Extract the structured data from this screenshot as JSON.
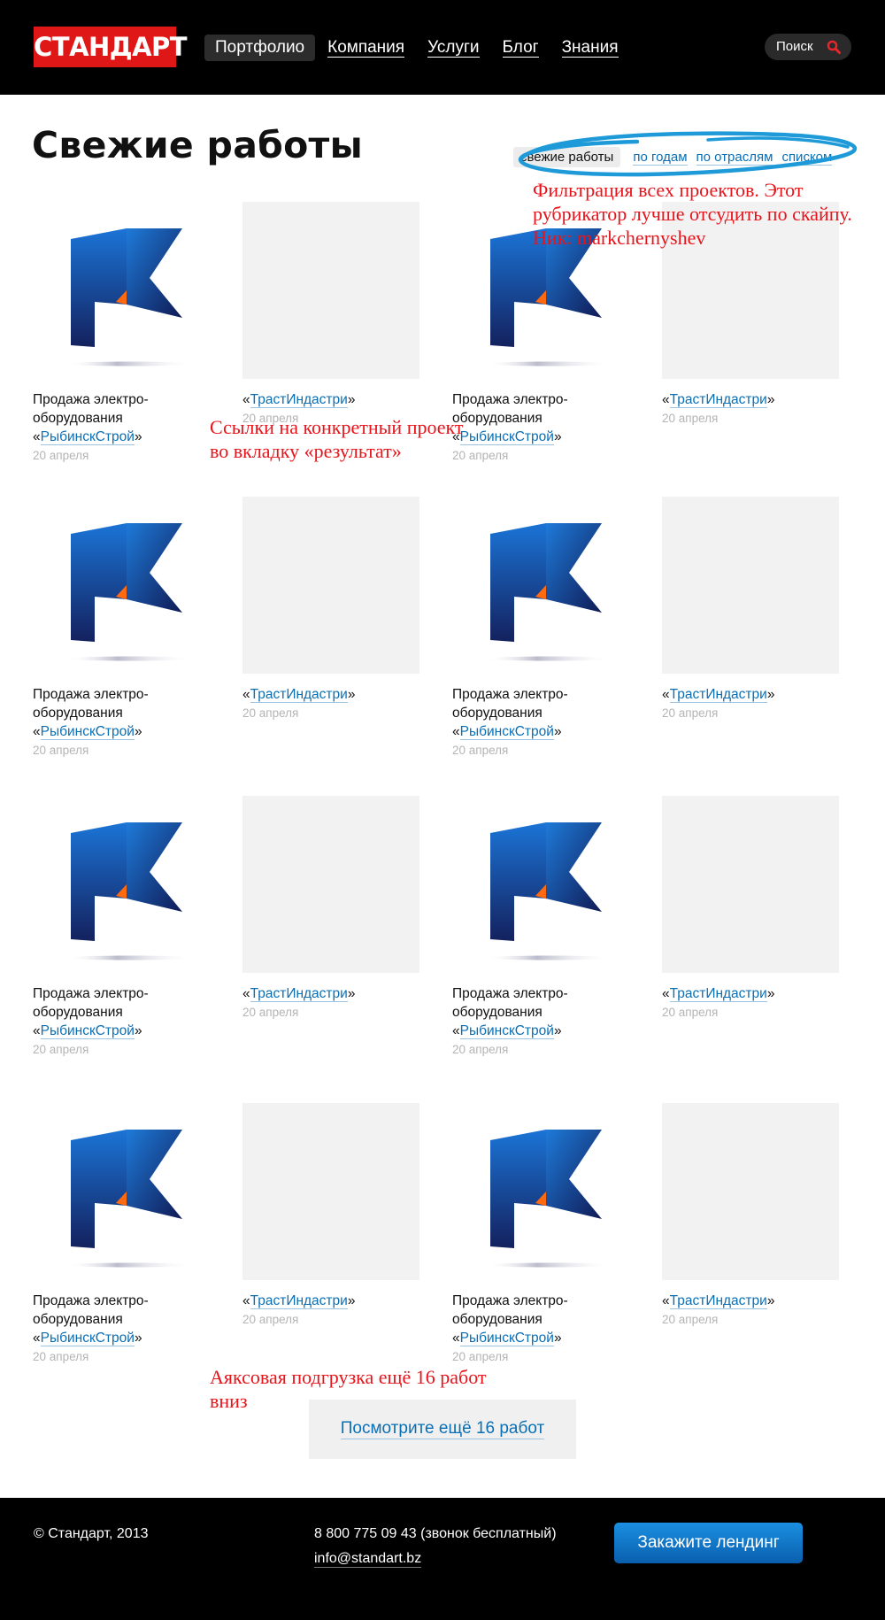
{
  "header": {
    "logo": "СТАНДАРТ",
    "nav": [
      "Портфолио",
      "Компания",
      "Услуги",
      "Блог",
      "Знания"
    ],
    "active_nav": "Портфолио",
    "search_label": "Поиск"
  },
  "main": {
    "title": "Свежие работы",
    "filter": {
      "active": "свежие работы",
      "links": [
        "по годам",
        "по отраслям",
        "списком"
      ]
    },
    "cards": {
      "a": {
        "text1": "Продажа электро-",
        "text2": "оборудования",
        "client": "РыбинскСтрой",
        "date": "20 апреля"
      },
      "b": {
        "client": "ТрастИндастри",
        "date": "20 апреля"
      }
    },
    "more_label": "Посмотрите ещё 16 работ"
  },
  "annotations": {
    "filter_note": "Фильтрация всех проектов. Этот рубрикатор лучше отсудить по скайпу. Ник: markchernyshev",
    "links_note": "Ссылки на конкретный проект во вкладку «результат»",
    "ajax_note": "Аяксовая подгрузка ещё 16 работ вниз"
  },
  "footer": {
    "copyright": "© Стандарт, 2013",
    "phone": "8 800 775 09 43 (звонок бесплатный)",
    "email": "info@standart.bz",
    "cta": "Закажите лендинг"
  },
  "colors": {
    "brand_red": "#e01717",
    "link_blue": "#0a6fb5",
    "annotation_red": "#e8141b",
    "scribble_blue": "#1e9ad8"
  }
}
